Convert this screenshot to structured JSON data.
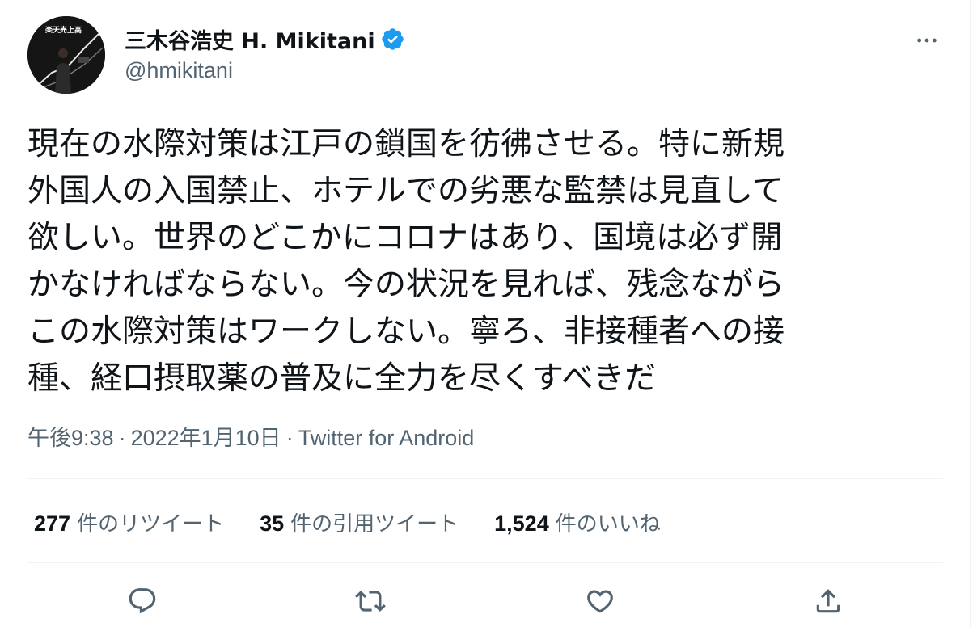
{
  "author": {
    "display_name": "三木谷浩史 H. Mikitani",
    "handle": "@hmikitani",
    "verified": true,
    "avatar_caption": "楽天売上高"
  },
  "tweet": {
    "text": "現在の水際対策は江戸の鎖国を彷彿させる。特に新規\n外国人の入国禁止、ホテルでの劣悪な監禁は見直して\n欲しい。世界のどこかにコロナはあり、国境は必ず開\nかなければならない。今の状況を見れば、残念ながら\nこの水際対策はワークしない。寧ろ、非接種者への接\n種、経口摂取薬の普及に全力を尽くすべきだ",
    "time": "午後9:38",
    "date": "2022年1月10日",
    "separator": "·",
    "source": "Twitter for Android"
  },
  "stats": {
    "retweets": {
      "count": "277",
      "label": "件のリツイート"
    },
    "quotes": {
      "count": "35",
      "label": "件の引用ツイート"
    },
    "likes": {
      "count": "1,524",
      "label": "件のいいね"
    }
  },
  "icons": {
    "more": "more-horizontal-icon",
    "reply": "reply-icon",
    "retweet": "retweet-icon",
    "like": "heart-icon",
    "share": "share-icon",
    "verified": "verified-badge-icon"
  },
  "colors": {
    "text": "#0f1419",
    "secondary": "#536471",
    "verified": "#1d9bf0",
    "divider": "#eff3f4"
  }
}
